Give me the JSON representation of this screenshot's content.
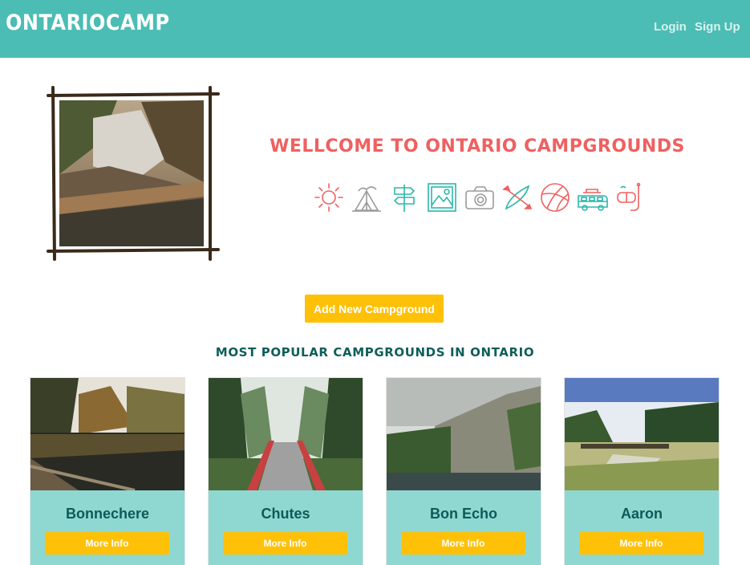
{
  "navbar": {
    "brand": "ONTARIOCAMP",
    "login": "Login",
    "signup": "Sign Up"
  },
  "hero": {
    "title": "WELLCOME TO ONTARIO CAMPGROUNDS",
    "icons": [
      "sun-icon",
      "tent-icon",
      "signpost-icon",
      "picture-icon",
      "camera-icon",
      "kayak-icon",
      "beach-ball-icon",
      "camper-van-icon",
      "snorkel-icon"
    ]
  },
  "add_button": "Add New Campground",
  "section_title": "MOST POPULAR CAMPGROUNDS IN ONTARIO",
  "cards": [
    {
      "name": "Bonnechere",
      "button": "More Info"
    },
    {
      "name": "Chutes",
      "button": "More Info"
    },
    {
      "name": "Bon Echo",
      "button": "More Info"
    },
    {
      "name": "Aaron",
      "button": "More Info"
    }
  ],
  "colors": {
    "navbar": "#4bbdb4",
    "title_red": "#f06060",
    "accent_yellow": "#ffc107",
    "card_bg": "#8fd8d2",
    "dark_teal": "#0e5a56"
  }
}
